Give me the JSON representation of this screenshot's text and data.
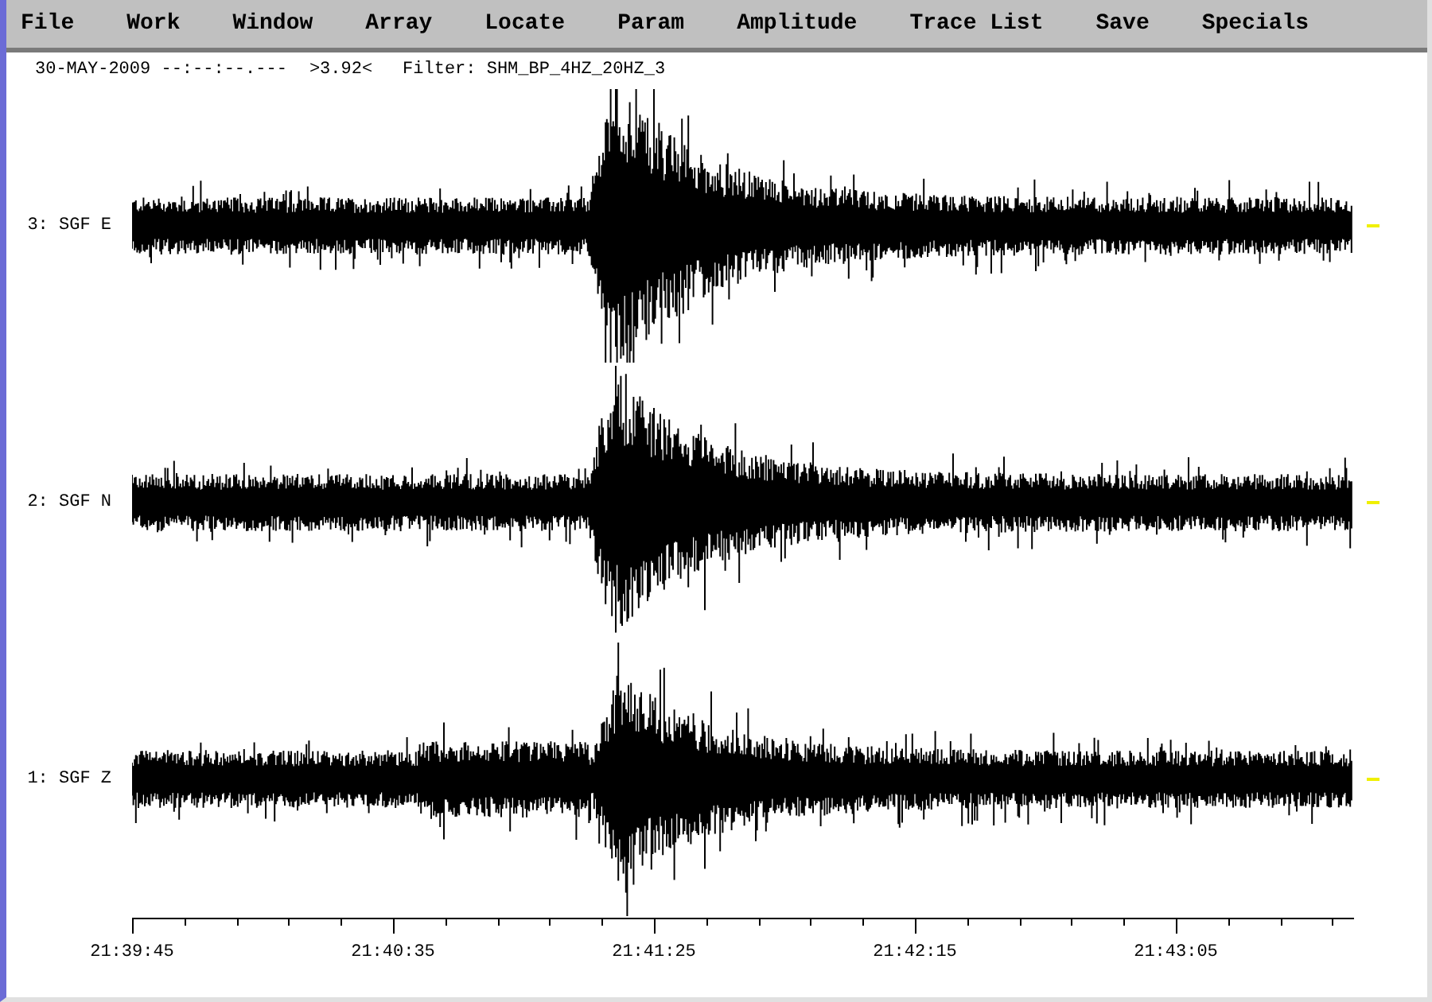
{
  "menu": [
    {
      "label": "File"
    },
    {
      "label": "Work"
    },
    {
      "label": "Window"
    },
    {
      "label": "Array"
    },
    {
      "label": "Locate"
    },
    {
      "label": "Param"
    },
    {
      "label": "Amplitude"
    },
    {
      "label": "Trace List"
    },
    {
      "label": "Save"
    },
    {
      "label": "Specials"
    }
  ],
  "header": {
    "time": "30-MAY-2009 --:--:--.---",
    "amplitude": ">3.92<",
    "filter": "Filter: SHM_BP_4HZ_20HZ_3"
  },
  "traces": [
    {
      "label": "3: SGF E"
    },
    {
      "label": "2: SGF N"
    },
    {
      "label": "1: SGF Z"
    }
  ],
  "time_axis": {
    "labels": [
      "21:39:45",
      "21:40:35",
      "21:41:25",
      "21:42:15",
      "21:43:05"
    ]
  }
}
